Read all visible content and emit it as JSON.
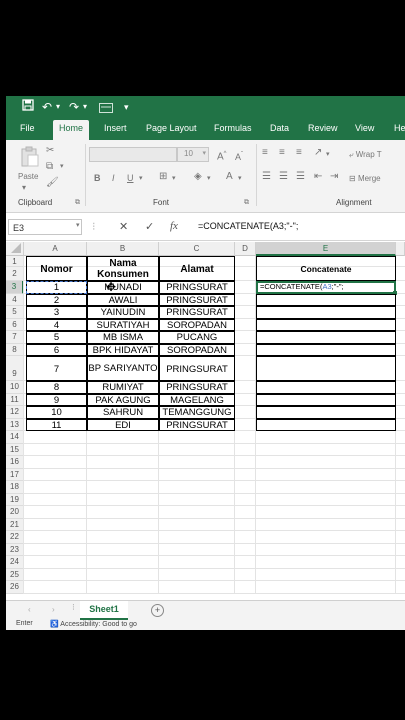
{
  "qat": {
    "save_icon": "save-icon",
    "undo_icon": "undo-icon",
    "redo_icon": "redo-icon",
    "dropdown": "▾",
    "more": "⁝"
  },
  "tabs": [
    "File",
    "Home",
    "Insert",
    "Page Layout",
    "Formulas",
    "Data",
    "Review",
    "View",
    "He"
  ],
  "active_tab": "Home",
  "ribbon": {
    "paste_label": "Paste",
    "font_name": "",
    "font_size": "10",
    "bold": "B",
    "italic": "I",
    "underline": "U",
    "wrap_text": "Wrap T",
    "merge": "Merge",
    "groups": {
      "clipboard": "Clipboard",
      "font": "Font",
      "alignment": "Alignment"
    }
  },
  "formula_bar": {
    "name_box": "E3",
    "formula": "=CONCATENATE(A3;\"-\";"
  },
  "columns": [
    "A",
    "B",
    "C",
    "D",
    "E"
  ],
  "rows": [
    "1",
    "2",
    "3",
    "4",
    "5",
    "6",
    "7",
    "8",
    "9",
    "10",
    "11",
    "12",
    "13",
    "14",
    "15",
    "16",
    "17",
    "18",
    "19",
    "20",
    "21",
    "22",
    "23",
    "24",
    "25",
    "26"
  ],
  "table": {
    "headers": {
      "nomor": "Nomor",
      "nama": "Nama Konsumen",
      "alamat": "Alamat"
    },
    "records": [
      {
        "nomor": "1",
        "nama": "MUNADI",
        "alamat": "PRINGSURAT"
      },
      {
        "nomor": "2",
        "nama": "AWALI",
        "alamat": "PRINGSURAT"
      },
      {
        "nomor": "3",
        "nama": "YAINUDIN",
        "alamat": "PRINGSURAT"
      },
      {
        "nomor": "4",
        "nama": "SURATIYAH",
        "alamat": "SOROPADAN"
      },
      {
        "nomor": "5",
        "nama": "MB ISMA",
        "alamat": "PUCANG"
      },
      {
        "nomor": "6",
        "nama": "BPK HIDAYAT",
        "alamat": "SOROPADAN"
      },
      {
        "nomor": "7",
        "nama": "BP SARIYANTO",
        "alamat": "PRINGSURAT"
      },
      {
        "nomor": "8",
        "nama": "RUMIYAT",
        "alamat": "PRINGSURAT"
      },
      {
        "nomor": "9",
        "nama": "PAK AGUNG",
        "alamat": "MAGELANG"
      },
      {
        "nomor": "10",
        "nama": "SAHRUN",
        "alamat": "TEMANGGUNG"
      },
      {
        "nomor": "11",
        "nama": "EDI",
        "alamat": "PRINGSURAT"
      }
    ]
  },
  "concat": {
    "header": "Concatenate",
    "edit_prefix": "=CONCATENATE(",
    "edit_ref": "A3",
    "edit_suffix": ";\"-\";"
  },
  "sheet": {
    "name": "Sheet1",
    "add": "+"
  },
  "status": {
    "mode": "Enter",
    "accessibility": "Accessibility: Good to go"
  },
  "colors": {
    "excel_green": "#217346",
    "ref_blue": "#4472c4"
  }
}
